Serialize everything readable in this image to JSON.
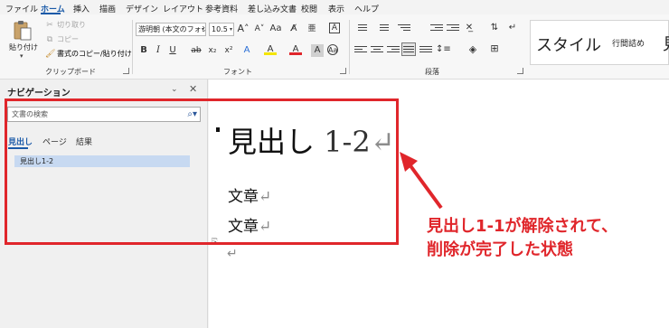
{
  "menu": {
    "tabs": [
      "ファイル",
      "ホーム",
      "挿入",
      "描画",
      "デザイン",
      "レイアウト",
      "参考資料",
      "差し込み文書",
      "校閲",
      "表示",
      "ヘルプ"
    ],
    "active_tab": "ホーム"
  },
  "ribbon": {
    "clipboard": {
      "paste": "貼り付け",
      "cut": "切り取り",
      "copy": "コピー",
      "format_painter": "書式のコピー/貼り付け",
      "group_label": "クリップボード"
    },
    "font": {
      "font_name": "游明朝 (本文のフォン",
      "font_size": "10.5",
      "group_label": "フォント",
      "buttons": [
        "B",
        "I",
        "U",
        "ab",
        "x₂",
        "x²",
        "A",
        "A",
        "A",
        "A",
        "Aa"
      ]
    },
    "paragraph": {
      "group_label": "段落"
    },
    "styles": {
      "style_main": "スタイル",
      "style_second": "行間詰め",
      "style_cut": "見"
    }
  },
  "nav": {
    "title": "ナビゲーション",
    "search_placeholder": "文書の検索",
    "tabs": [
      "見出し",
      "ページ",
      "結果"
    ],
    "items": [
      {
        "label": "見出し1-2"
      }
    ]
  },
  "document": {
    "heading_text": "見出し",
    "heading_number": "1-2",
    "para_mark": "↵",
    "lines": [
      "文章",
      "文章"
    ]
  },
  "annotation": {
    "line1": "見出し1-1が解除されて、",
    "line2": "削除が完了した状態",
    "color": "#e0262b"
  }
}
